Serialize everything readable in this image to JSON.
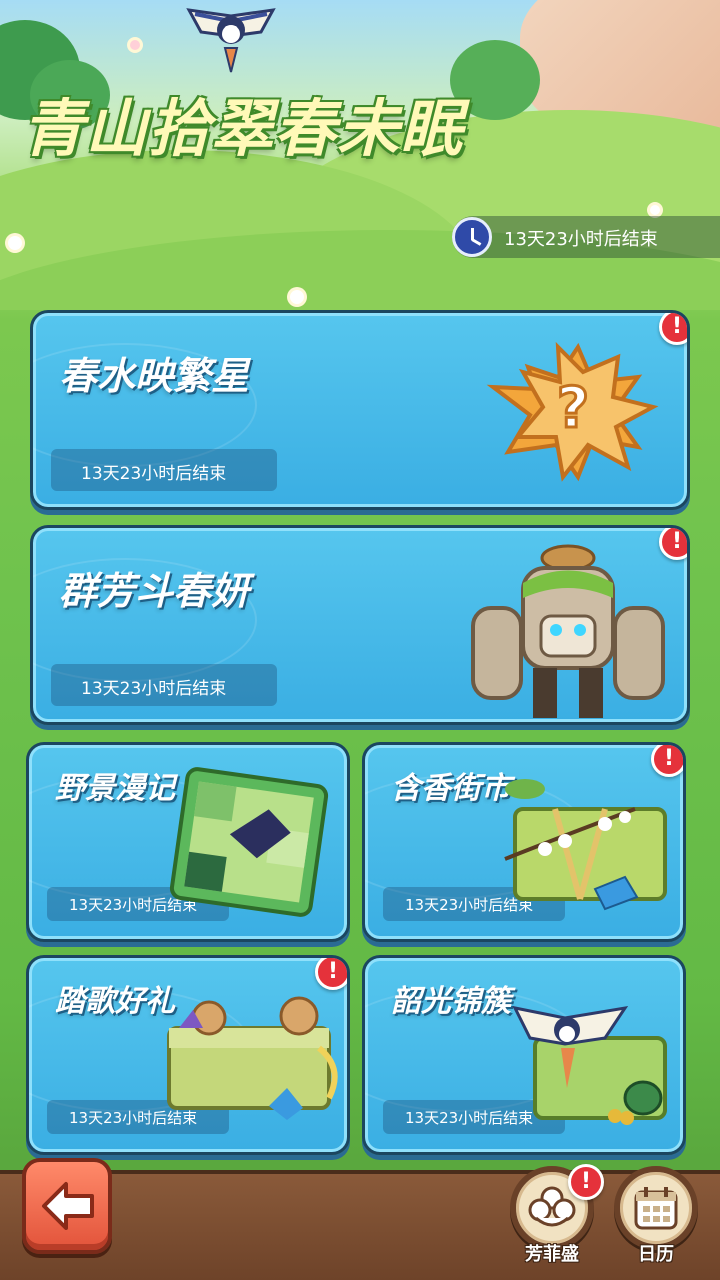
{
  "header": {
    "title": "青山拾翠春未眠",
    "timer_text": "13天23小时后结束"
  },
  "cards": [
    {
      "id": "spring-water",
      "label": "春水映繁星",
      "timer": "13天23小时后结束",
      "alert": true,
      "icon": "mystery-star-icon"
    },
    {
      "id": "flowers-contest",
      "label": "群芳斗春妍",
      "timer": "13天23小时后结束",
      "alert": true,
      "icon": "stone-golem-icon"
    },
    {
      "id": "wild-scenery",
      "label": "野景漫记",
      "timer": "13天23小时后结束",
      "alert": false,
      "icon": "puzzle-picture-icon"
    },
    {
      "id": "fragrant-market",
      "label": "含香街市",
      "timer": "13天23小时后结束",
      "alert": true,
      "icon": "gift-box-flowers-icon"
    },
    {
      "id": "song-gift",
      "label": "踏歌好礼",
      "timer": "13天23小时后结束",
      "alert": true,
      "icon": "treasure-chest-icon"
    },
    {
      "id": "brocade-cluster",
      "label": "韶光锦簇",
      "timer": "13天23小时后结束",
      "alert": false,
      "icon": "kite-gift-icon"
    }
  ],
  "bottom": {
    "back_icon": "arrow-left-icon",
    "flower_button_label": "芳菲盛",
    "calendar_button_label": "日历"
  },
  "colors": {
    "card_blue": "#3aaee3",
    "alert_red": "#e5323b",
    "title_yellow": "#fff9b8"
  }
}
